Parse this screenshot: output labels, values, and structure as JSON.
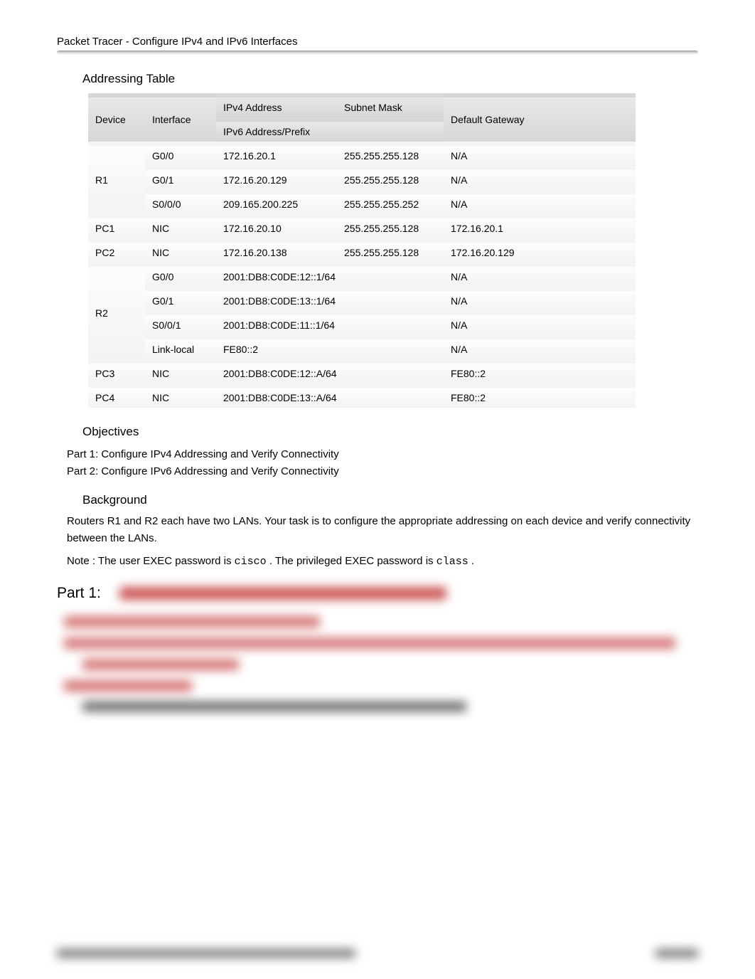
{
  "header": "Packet Tracer - Configure IPv4 and IPv6 Interfaces",
  "addressing_title": "Addressing Table",
  "table_headers": {
    "device": "Device",
    "interface": "Interface",
    "ipv4": "IPv4 Address",
    "subnet": "Subnet Mask",
    "ipv6": "IPv6 Address/Prefix",
    "gateway": "Default Gateway"
  },
  "r1": {
    "name": "R1",
    "rows": [
      {
        "iface": "G0/0",
        "ip": "172.16.20.1",
        "mask": "255.255.255.128",
        "gw": "N/A"
      },
      {
        "iface": "G0/1",
        "ip": "172.16.20.129",
        "mask": "255.255.255.128",
        "gw": "N/A"
      },
      {
        "iface": "S0/0/0",
        "ip": "209.165.200.225",
        "mask": "255.255.255.252",
        "gw": "N/A"
      }
    ]
  },
  "pc1": {
    "name": "PC1",
    "iface": "NIC",
    "ip": "172.16.20.10",
    "mask": "255.255.255.128",
    "gw": "172.16.20.1"
  },
  "pc2": {
    "name": "PC2",
    "iface": "NIC",
    "ip": "172.16.20.138",
    "mask": "255.255.255.128",
    "gw": "172.16.20.129"
  },
  "r2": {
    "name": "R2",
    "rows": [
      {
        "iface": "G0/0",
        "addr": "2001:DB8:C0DE:12::1/64",
        "gw": "N/A"
      },
      {
        "iface": "G0/1",
        "addr": "2001:DB8:C0DE:13::1/64",
        "gw": "N/A"
      },
      {
        "iface": "S0/0/1",
        "addr": "2001:DB8:C0DE:11::1/64",
        "gw": "N/A"
      },
      {
        "iface": "Link-local",
        "addr": "FE80::2",
        "gw": "N/A"
      }
    ]
  },
  "pc3": {
    "name": "PC3",
    "iface": "NIC",
    "addr": "2001:DB8:C0DE:12::A/64",
    "gw": "FE80::2"
  },
  "pc4": {
    "name": "PC4",
    "iface": "NIC",
    "addr": "2001:DB8:C0DE:13::A/64",
    "gw": "FE80::2"
  },
  "objectives_title": "Objectives",
  "objectives": [
    "Part 1: Configure IPv4 Addressing and Verify Connectivity",
    "Part 2: Configure IPv6 Addressing and Verify Connectivity"
  ],
  "background_title": "Background",
  "background_text": "Routers R1 and R2 each have two LANs. Your task is to configure the appropriate addressing on each device and verify connectivity between the LANs.",
  "note_prefix": "Note : The user EXEC password is ",
  "note_pw1": "cisco",
  "note_mid": " . The privileged EXEC password is ",
  "note_pw2": "class",
  "note_end": " .",
  "part1_label": "Part 1:"
}
